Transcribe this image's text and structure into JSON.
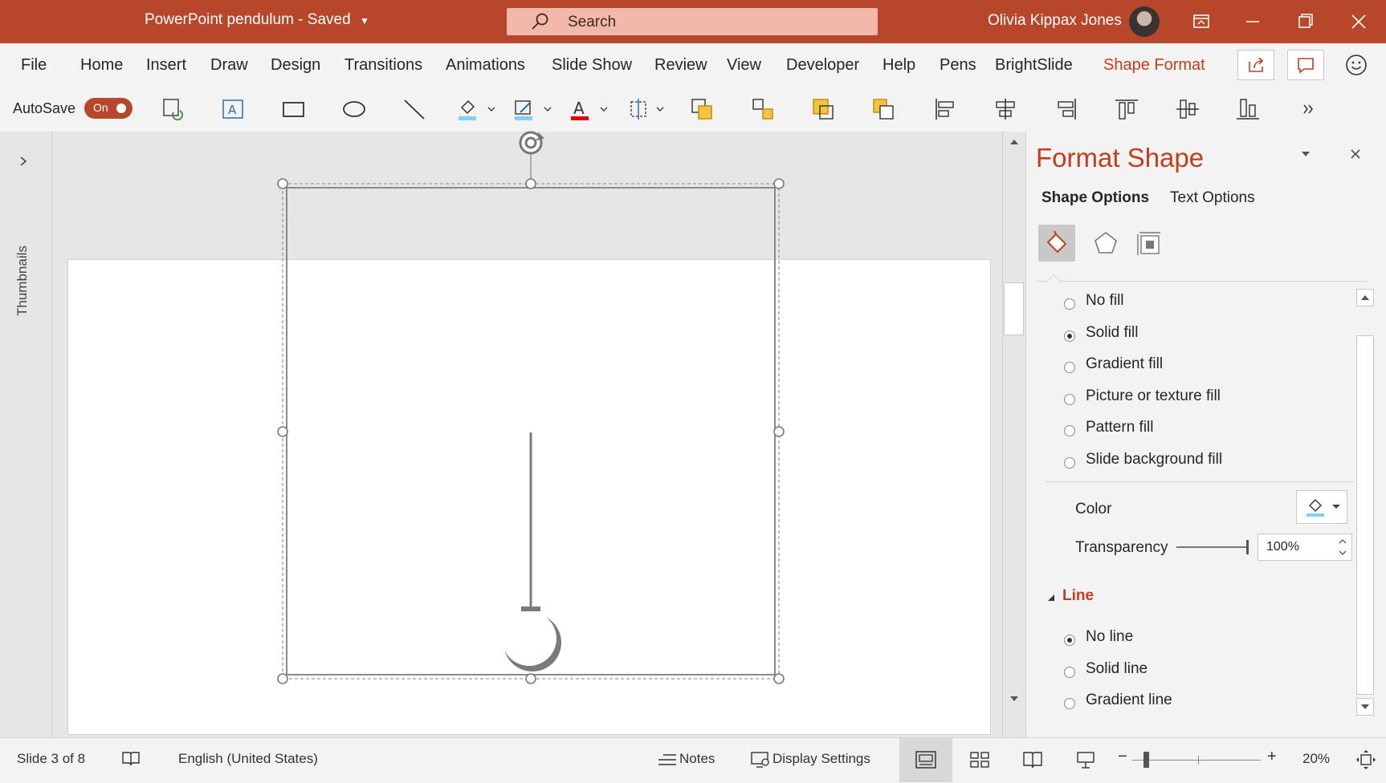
{
  "titlebar": {
    "doc_title": "PowerPoint pendulum  -  Saved",
    "search_placeholder": "Search",
    "user_name": "Olivia Kippax Jones"
  },
  "menu": {
    "items": [
      "File",
      "Home",
      "Insert",
      "Draw",
      "Design",
      "Transitions",
      "Animations",
      "Slide Show",
      "Review",
      "View",
      "Developer",
      "Help",
      "Pens",
      "BrightSlide",
      "Shape Format"
    ],
    "active": "Shape Format"
  },
  "ribbon": {
    "autosave_label": "AutoSave",
    "autosave_state": "On",
    "icons": [
      "sync-icon",
      "text-box-icon",
      "rectangle-icon",
      "oval-icon",
      "line-icon",
      "shape-fill-icon",
      "shape-outline-icon",
      "font-color-icon",
      "size-icon",
      "bring-forward-icon",
      "group-icon",
      "send-backward-icon",
      "selection-pane-icon",
      "align-left-icon",
      "align-center-icon",
      "align-right-icon",
      "align-top-icon",
      "align-middle-icon",
      "align-bottom-icon",
      "more-icon"
    ]
  },
  "sidebar": {
    "thumbnails_label": "Thumbnails"
  },
  "panel": {
    "title": "Format Shape",
    "tabs": [
      "Shape Options",
      "Text Options"
    ],
    "active_tab": "Shape Options",
    "fill_options": [
      {
        "label": "No fill",
        "selected": false
      },
      {
        "label": "Solid fill",
        "selected": true
      },
      {
        "label": "Gradient fill",
        "selected": false
      },
      {
        "label": "Picture or texture fill",
        "selected": false
      },
      {
        "label": "Pattern fill",
        "selected": false
      },
      {
        "label": "Slide background fill",
        "selected": false
      }
    ],
    "color_label": "Color",
    "transparency_label": "Transparency",
    "transparency_value": "100%",
    "line_section": "Line",
    "line_options": [
      {
        "label": "No line",
        "selected": true
      },
      {
        "label": "Solid line",
        "selected": false
      },
      {
        "label": "Gradient line",
        "selected": false
      }
    ]
  },
  "status": {
    "slide_info": "Slide 3 of 8",
    "language": "English (United States)",
    "notes": "Notes",
    "display_settings": "Display Settings",
    "zoom": "20%"
  },
  "colors": {
    "accent": "#b7472a",
    "active_text": "#c43e1c"
  }
}
